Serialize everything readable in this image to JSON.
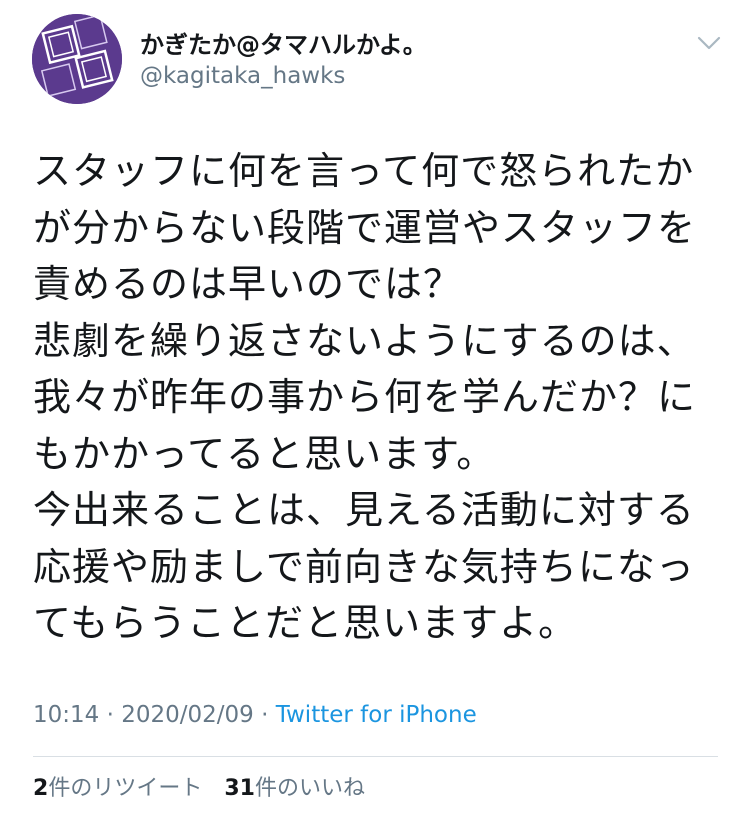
{
  "user": {
    "display_name": "かぎたか@タマハルかよ。",
    "handle": "@kagitaka_hawks"
  },
  "tweet": {
    "lines": [
      "スタッフに何を言って何で怒られたか",
      "が分からない段階で運営やスタッフを",
      "責めるのは早いのでは？",
      "悲劇を繰り返さないようにするのは、",
      "我々が昨年の事から何を学んだか？に",
      "もかかってると思います。",
      "今出来ることは、見える活動に対する",
      "応援や励ましで前向きな気持ちになっ",
      "てもらうことだと思いますよ。"
    ]
  },
  "meta": {
    "time": "10:14",
    "separator": "·",
    "date": "2020/02/09",
    "source": "Twitter for iPhone"
  },
  "stats": {
    "retweet_count": "2",
    "retweet_label": "件のリツイート",
    "like_count": "31",
    "like_label": "件のいいね"
  },
  "icons": {
    "menu": "chevron-down-icon",
    "avatar": "avatar"
  },
  "colors": {
    "text": "#14171a",
    "secondary": "#657786",
    "link": "#1b95e0",
    "avatar_bg": "#5b3a8e"
  }
}
